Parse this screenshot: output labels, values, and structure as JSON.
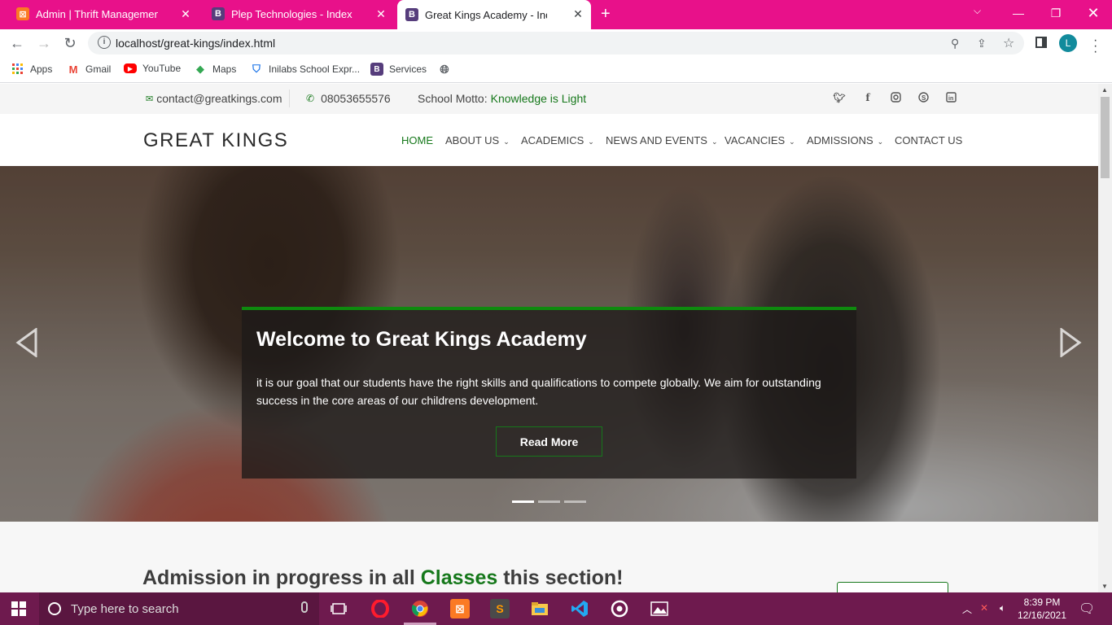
{
  "browser": {
    "tabs": [
      {
        "title": "Admin | Thrift Management Syste",
        "icon": "xampp-icon",
        "active": false
      },
      {
        "title": "Plep Technologies - Index",
        "icon": "bootstrap-icon",
        "active": false
      },
      {
        "title": "Great Kings Academy - Index",
        "icon": "bootstrap-icon",
        "active": true
      }
    ],
    "url": "localhost/great-kings/index.html",
    "profile_initial": "L",
    "bookmarks": [
      {
        "label": "Apps",
        "icon": "apps-grid-icon"
      },
      {
        "label": "Gmail",
        "icon": "gmail-icon"
      },
      {
        "label": "YouTube",
        "icon": "youtube-icon"
      },
      {
        "label": "Maps",
        "icon": "maps-icon"
      },
      {
        "label": "Inilabs School Expr...",
        "icon": "shield-icon"
      },
      {
        "label": "Services",
        "icon": "bootstrap-icon"
      },
      {
        "label": "",
        "icon": "globe-icon"
      }
    ],
    "colors": {
      "tab_strip": "#e8118a"
    }
  },
  "site": {
    "topbar": {
      "email": "contact@greatkings.com",
      "phone": "08053655576",
      "motto_label": "School Motto:",
      "motto": "Knowledge is Light",
      "social": [
        "twitter-icon",
        "facebook-icon",
        "instagram-icon",
        "skype-icon",
        "linkedin-icon"
      ]
    },
    "logo": "GREAT KINGS",
    "nav": [
      {
        "label": "HOME",
        "active": true,
        "dropdown": false
      },
      {
        "label": "ABOUT US",
        "active": false,
        "dropdown": true
      },
      {
        "label": "ACADEMICS",
        "active": false,
        "dropdown": true
      },
      {
        "label": "NEWS AND EVENTS",
        "active": false,
        "dropdown": true
      },
      {
        "label": "VACANCIES",
        "active": false,
        "dropdown": true
      },
      {
        "label": "ADMISSIONS",
        "active": false,
        "dropdown": true
      },
      {
        "label": "CONTACT US",
        "active": false,
        "dropdown": false
      }
    ],
    "hero": {
      "title": "Welcome to Great Kings Academy",
      "text": "it is our goal that our students have the right skills and qualifications to compete globally. We aim for outstanding success in the core areas of our childrens development.",
      "button": "Read More",
      "slides": 3,
      "active_slide": 1
    },
    "admission": {
      "pre": "Admission in progress in all",
      "highlight": "Classes",
      "post": "this section!"
    },
    "colors": {
      "accent": "#16781b"
    }
  },
  "taskbar": {
    "search_placeholder": "Type here to search",
    "time": "8:39 PM",
    "date": "12/16/2021"
  }
}
